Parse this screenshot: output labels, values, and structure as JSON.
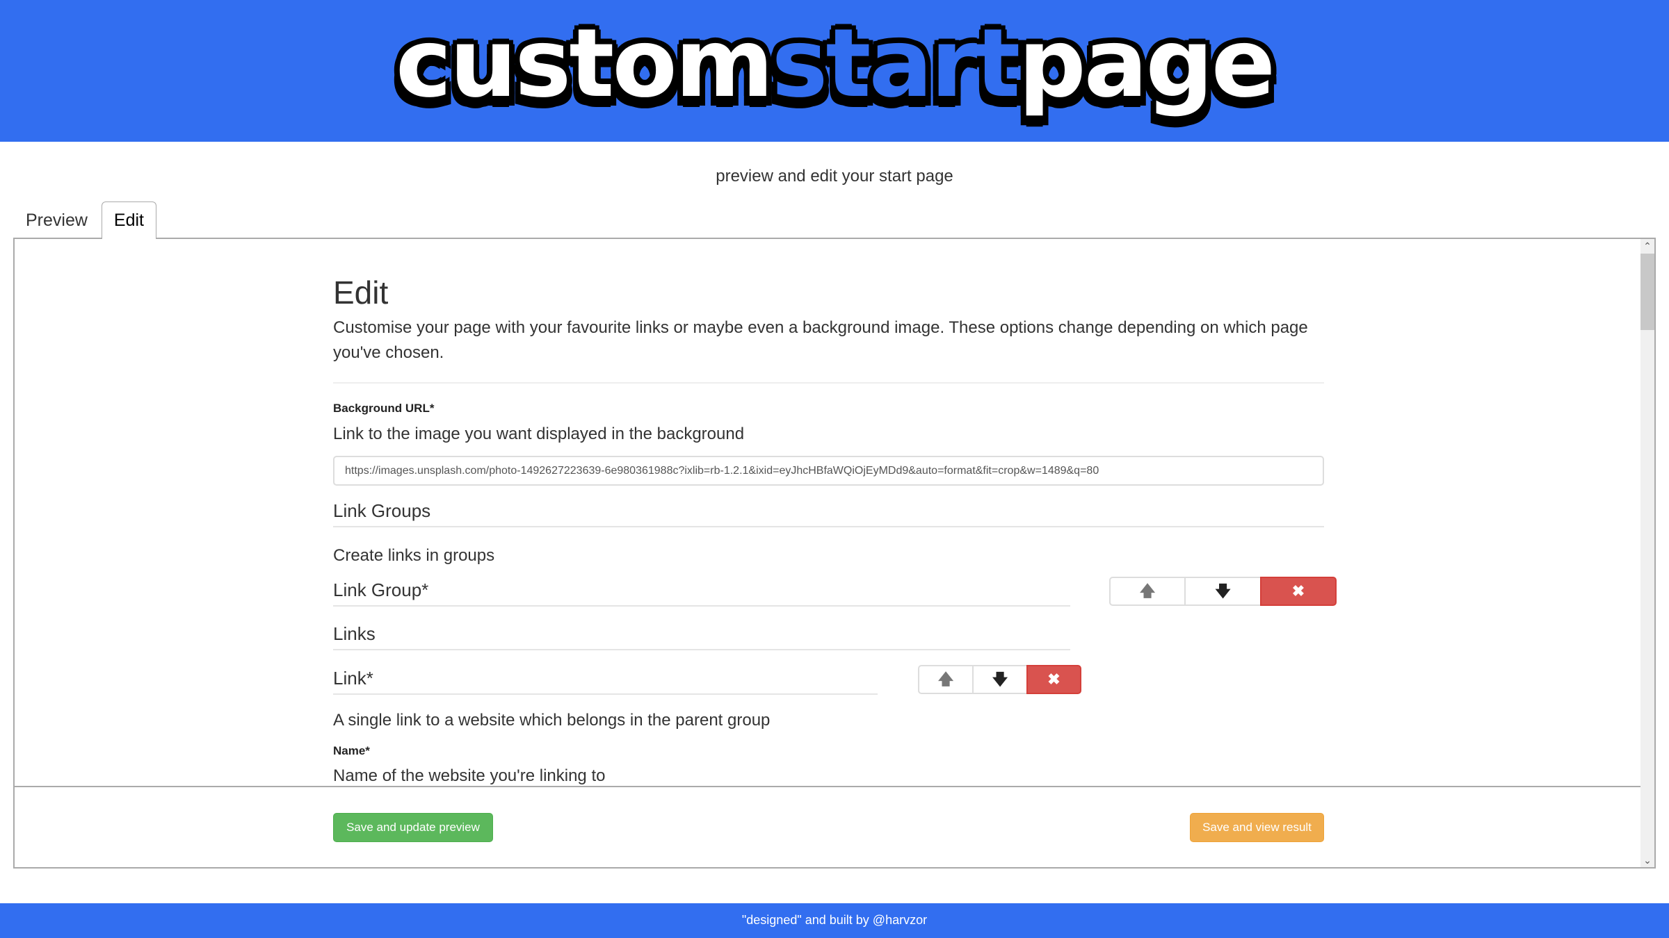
{
  "header": {
    "logo_part1": "custom",
    "logo_part2": "start",
    "logo_part3": "page",
    "brand_color": "#326ef0"
  },
  "subtitle": "preview and edit your start page",
  "tabs": [
    {
      "label": "Preview",
      "active": false
    },
    {
      "label": "Edit",
      "active": true
    }
  ],
  "edit": {
    "title": "Edit",
    "lead": "Customise your page with your favourite links or maybe even a background image. These options change depending on which page you've chosen.",
    "background": {
      "label": "Background URL*",
      "description": "Link to the image you want displayed in the background",
      "value": "https://images.unsplash.com/photo-1492627223639-6e980361988c?ixlib=rb-1.2.1&ixid=eyJhcHBfaWQiOjEyMDd9&auto=format&fit=crop&w=1489&q=80"
    },
    "link_groups": {
      "legend": "Link Groups",
      "description": "Create links in groups",
      "group": {
        "legend": "Link Group*",
        "controls": {
          "up_icon": "arrow-up-icon",
          "down_icon": "arrow-down-icon",
          "remove_icon": "close-icon"
        }
      },
      "links": {
        "legend": "Links",
        "link": {
          "legend": "Link*",
          "description": "A single link to a website which belongs in the parent group",
          "controls": {
            "up_icon": "arrow-up-icon",
            "down_icon": "arrow-down-icon",
            "remove_icon": "close-icon"
          },
          "name_label": "Name*",
          "name_description": "Name of the website you're linking to"
        }
      }
    }
  },
  "icons": {
    "up": "🡅",
    "down": "🡇",
    "remove": "✖",
    "scroll_up": "^",
    "scroll_down": "v"
  },
  "actions": {
    "save_update": "Save and update preview",
    "save_view": "Save and view result",
    "success_color": "#5cb85c",
    "warning_color": "#f0ad4e",
    "danger_color": "#d9534f"
  },
  "footer": "\"designed\" and built by @harvzor"
}
